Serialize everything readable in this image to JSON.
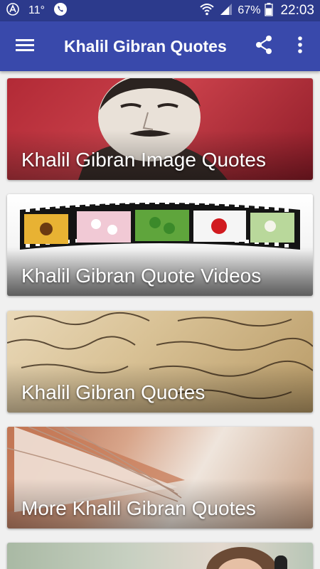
{
  "status_bar": {
    "temperature": "11°",
    "battery": "67%",
    "time": "22:03"
  },
  "app_bar": {
    "title": "Khalil Gibran Quotes"
  },
  "cards": [
    {
      "label": "Khalil Gibran Image Quotes"
    },
    {
      "label": "Khalil Gibran Quote Videos"
    },
    {
      "label": "Khalil Gibran Quotes"
    },
    {
      "label": "More Khalil Gibran Quotes"
    },
    {
      "label": ""
    }
  ],
  "colors": {
    "status_bar": "#2c3a8c",
    "app_bar": "#3949ab",
    "background": "#f0f0f0"
  }
}
